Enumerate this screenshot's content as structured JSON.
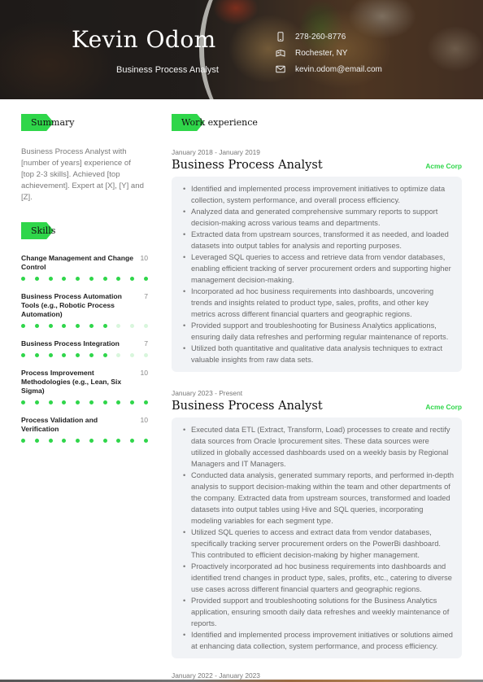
{
  "header": {
    "name": "Kevin Odom",
    "role": "Business Process Analyst",
    "contacts": [
      {
        "icon": "phone-icon",
        "value": "278-260-8776"
      },
      {
        "icon": "location-icon",
        "value": "Rochester, NY"
      },
      {
        "icon": "email-icon",
        "value": "kevin.odom@email.com"
      }
    ]
  },
  "summary": {
    "heading": "Summary",
    "text": "Business Process Analyst with [number of years] experience of [top 2-3 skills]. Achieved [top achievement]. Expert at [X], [Y] and [Z]."
  },
  "skills": {
    "heading": "Skills",
    "max_level": 10,
    "items": [
      {
        "name": "Change Management and Change Control",
        "level": 10
      },
      {
        "name": "Business Process Automation Tools (e.g., Robotic Process Automation)",
        "level": 7
      },
      {
        "name": "Business Process Integration",
        "level": 7
      },
      {
        "name": "Process Improvement Methodologies (e.g., Lean, Six Sigma)",
        "level": 10
      },
      {
        "name": "Process Validation and Verification",
        "level": 10
      }
    ]
  },
  "work": {
    "heading": "Work experience",
    "jobs": [
      {
        "date": "January 2018 - January 2019",
        "title": "Business Process Analyst",
        "company": "Acme Corp",
        "bullets": [
          "Identified and implemented process improvement initiatives to optimize data collection, system performance, and overall process efficiency.",
          "Analyzed data and generated comprehensive summary reports to support decision-making across various teams and departments.",
          "Extracted data from upstream sources, transformed it as needed, and loaded datasets into output tables for analysis and reporting purposes.",
          "Leveraged SQL queries to access and retrieve data from vendor databases, enabling efficient tracking of server procurement orders and supporting higher management decision-making.",
          "Incorporated ad hoc business requirements into dashboards, uncovering trends and insights related to product type, sales, profits, and other key metrics across different financial quarters and geographic regions.",
          "Provided support and troubleshooting for Business Analytics applications, ensuring daily data refreshes and performing regular maintenance of reports.",
          "Utilized both quantitative and qualitative data analysis techniques to extract valuable insights from raw data sets."
        ]
      },
      {
        "date": "January 2023 - Present",
        "title": "Business Process Analyst",
        "company": "Acme Corp",
        "bullets": [
          "Executed data ETL (Extract, Transform, Load) processes to create and rectify data sources from Oracle Iprocurement sites. These data sources were utilized in globally accessed dashboards used on a weekly basis by Regional Managers and IT Managers.",
          "Conducted data analysis, generated summary reports, and performed in-depth analysis to support decision-making within the team and other departments of the company. Extracted data from upstream sources, transformed and loaded datasets into output tables using Hive and SQL queries, incorporating modeling variables for each segment type.",
          "Utilized SQL queries to access and extract data from vendor databases, specifically tracking server procurement orders on the PowerBi dashboard. This contributed to efficient decision-making by higher management.",
          "Proactively incorporated ad hoc business requirements into dashboards and identified trend changes in product type, sales, profits, etc., catering to diverse use cases across different financial quarters and geographic regions.",
          "Provided support and troubleshooting solutions for the Business Analytics application, ensuring smooth daily data refreshes and weekly maintenance of reports.",
          "Identified and implemented process improvement initiatives or solutions aimed at enhancing data collection, system performance, and process efficiency."
        ]
      }
    ],
    "next_job_date": "January 2022 - January 2023"
  },
  "colors": {
    "accent": "#2fd64a",
    "accent_light": "#d8f6dc",
    "box_bg": "#f1f3f6"
  }
}
